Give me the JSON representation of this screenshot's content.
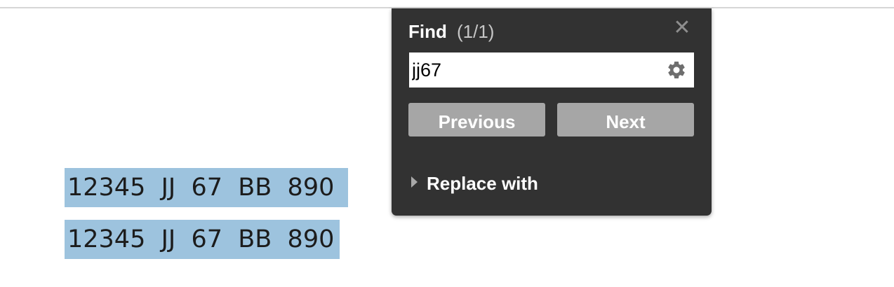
{
  "document": {
    "lines": [
      "12345  JJ  67  BB  890",
      "12345  JJ  67  BB  890"
    ],
    "highlight_color": "#9dc3de"
  },
  "find_panel": {
    "title": "Find",
    "match_count": "(1/1)",
    "close_icon": "close-icon",
    "search_value": "jj67",
    "settings_icon": "gear-icon",
    "previous_label": "Previous",
    "next_label": "Next",
    "replace_label": "Replace with",
    "colors": {
      "panel_bg": "#323232",
      "button_bg": "#a6a6a6",
      "text": "#ffffff"
    }
  }
}
